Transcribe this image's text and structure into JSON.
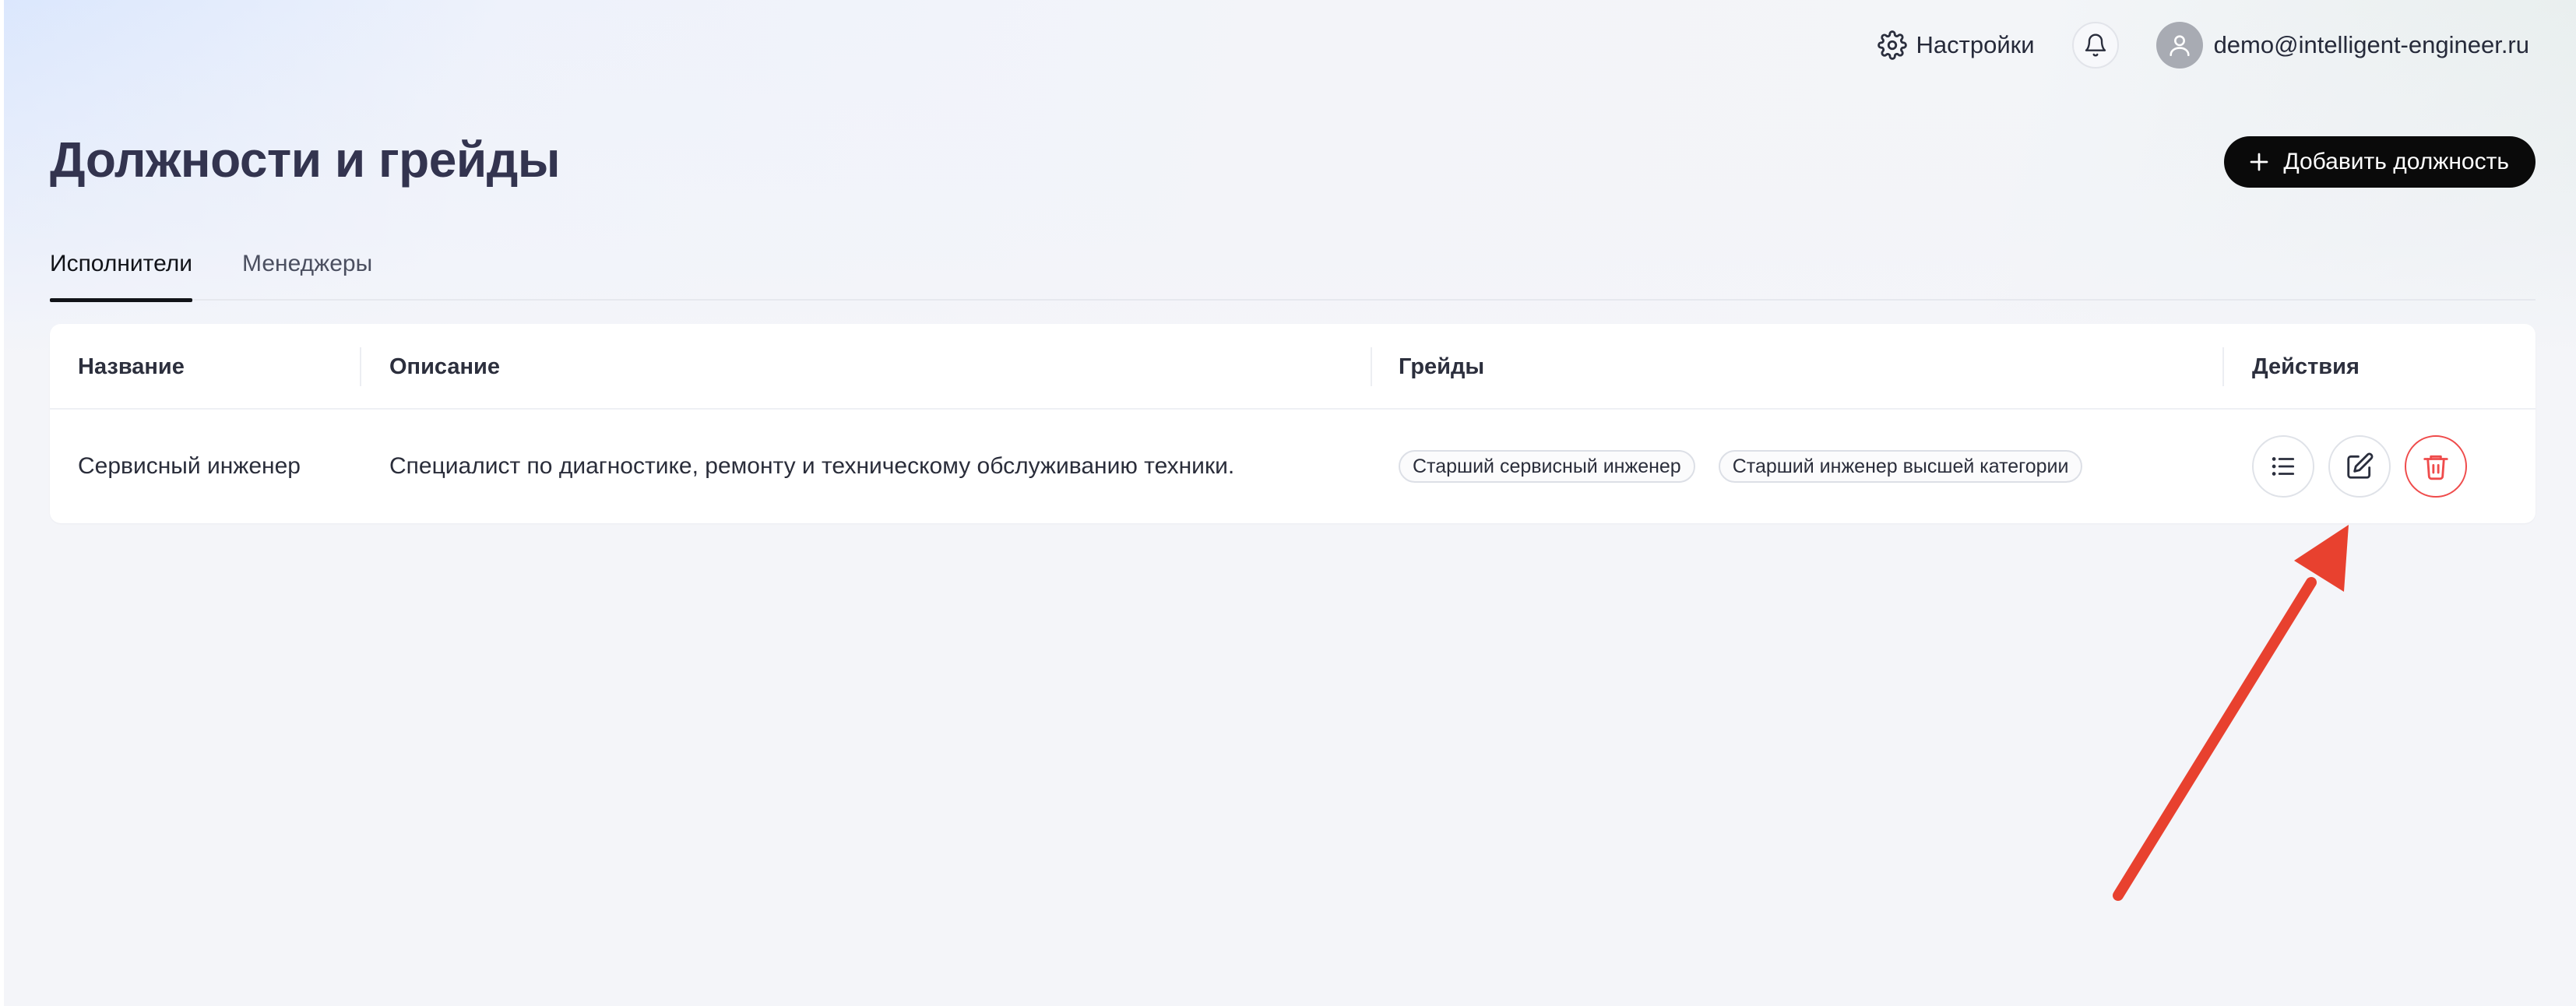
{
  "header": {
    "settings_label": "Настройки",
    "user_email": "demo@intelligent-engineer.ru"
  },
  "page": {
    "title": "Должности и грейды",
    "add_button_label": "Добавить должность"
  },
  "tabs": [
    {
      "label": "Исполнители",
      "active": true
    },
    {
      "label": "Менеджеры",
      "active": false
    }
  ],
  "table": {
    "columns": {
      "name": "Название",
      "description": "Описание",
      "grades": "Грейды",
      "actions": "Действия"
    },
    "rows": [
      {
        "name": "Сервисный инженер",
        "description": "Специалист по диагностике, ремонту и техническому обслуживанию техники.",
        "grades": [
          "Старший сервисный инженер",
          "Старший инженер высшей категории"
        ]
      }
    ]
  },
  "icons": {
    "settings": "gear-icon",
    "notifications": "bell-icon",
    "avatar": "user-icon",
    "add": "plus-icon",
    "list": "list-icon",
    "edit": "edit-icon",
    "delete": "trash-icon",
    "annotation": "arrow-annotation"
  },
  "colors": {
    "primary_button": "#0a0a0a",
    "danger": "#ef4b4b",
    "annotation_arrow": "#e8412f",
    "title": "#33344f"
  }
}
